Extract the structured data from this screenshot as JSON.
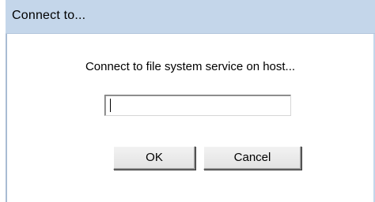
{
  "window": {
    "title": "Connect to..."
  },
  "dialog": {
    "prompt": "Connect to file system service on host...",
    "host_input": {
      "value": "",
      "placeholder": ""
    },
    "ok_label": "OK",
    "cancel_label": "Cancel"
  }
}
